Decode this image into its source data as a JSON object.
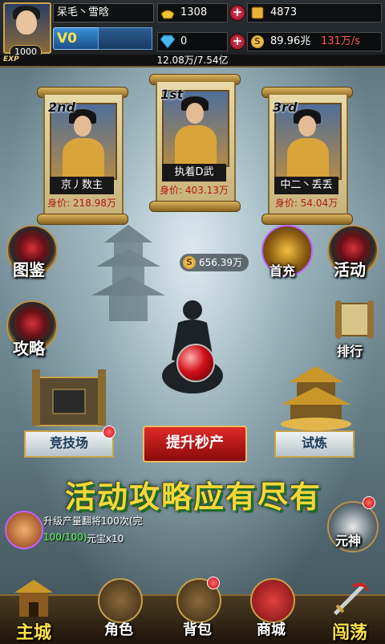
{
  "player": {
    "name": "呆毛丶雪晗",
    "level": "1000",
    "vip": "V0"
  },
  "resources": {
    "ingot": "1308",
    "gold_leaf": "4873",
    "diamond": "0",
    "money": "89.96兆",
    "income_rate": "131万/s"
  },
  "exp": {
    "label": "EXP",
    "text": "12.08万/7.54亿"
  },
  "rankings": [
    {
      "rank": "2nd",
      "name": "京丿数主",
      "value": "身价: 218.98万"
    },
    {
      "rank": "1st",
      "name": "执着D武",
      "value": "身价: 403.13万"
    },
    {
      "rank": "3rd",
      "name": "中二丶丢丢",
      "value": "身价: 54.04万"
    }
  ],
  "side_buttons": {
    "codex": "图鉴",
    "guide": "攻略",
    "treasure": "首充",
    "event": "活动",
    "ranking": "排行"
  },
  "idle_gold": "656.39万",
  "coin_glyph": "S",
  "arena_label": "竞技场",
  "trial_label": "试炼",
  "boost_label": "提升秒产",
  "banner_text": "活动攻略应有尽有",
  "quest": {
    "title": "升级产量翻将100次(完",
    "progress": "100/100)",
    "reward": "元宝x10"
  },
  "soul_label": "元神",
  "nav": {
    "main_city": "主城",
    "character": "角色",
    "backpack": "背包",
    "shop": "商城",
    "adventure": "闯荡"
  },
  "colors": {
    "accent_gold": "#c9a24a",
    "rate_red": "#ff5a5a",
    "banner_yellow": "#f7d63a"
  }
}
